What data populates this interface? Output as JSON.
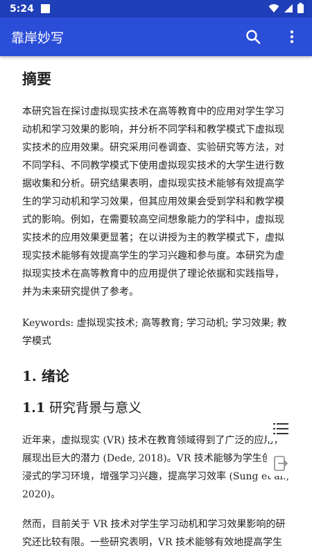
{
  "status_bar": {
    "time": "5:24"
  },
  "app_bar": {
    "title": "靠岸妙写",
    "icons": [
      "search-icon",
      "more-vert-icon"
    ]
  },
  "document": {
    "abstract_title": "摘要",
    "abstract_text": "本研究旨在探讨虚拟现实技术在高等教育中的应用对学生学习动机和学习效果的影响，并分析不同学科和教学模式下虚拟现实技术的应用效果。研究采用问卷调查、实验研究等方法，对不同学科、不同教学模式下使用虚拟现实技术的大学生进行数据收集和分析。研究结果表明，虚拟现实技术能够有效提高学生的学习动机和学习效果，但其应用效果会受到学科和教学模式的影响。例如，在需要较高空间想象能力的学科中，虚拟现实技术的应用效果更显著；在以讲授为主的教学模式下，虚拟现实技术能够有效提高学生的学习兴趣和参与度。本研究为虚拟现实技术在高等教育中的应用提供了理论依据和实践指导，并为未来研究提供了参考。",
    "keywords": "Keywords: 虚拟现实技术; 高等教育; 学习动机; 学习效果; 教学模式",
    "section1_title": "1. 绪论",
    "section1_1_num": "1.1",
    "section1_1_title": "研究背景与意义",
    "para1": "近年来，虚拟现实 (VR) 技术在教育领域得到了广泛的应用，展现出巨大的潜力 (Dede, 2018)。VR 技术能够为学生创造沉浸式的学习环境，增强学习兴趣，提高学习效率 (Sung et al., 2020)。",
    "para2": "然而，目前关于 VR 技术对学生学习动机和学习效果影响的研究还比较有限。一些研究表明，VR 技术能够有效地提高学生"
  },
  "floating_panel": {
    "icons": [
      "outline-list-icon",
      "export-icon"
    ]
  }
}
